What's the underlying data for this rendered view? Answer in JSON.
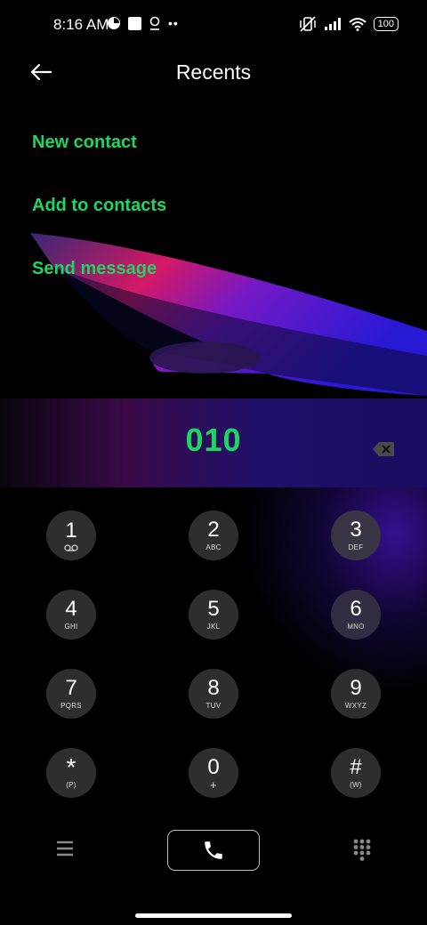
{
  "status_bar": {
    "time": "8:16 AM",
    "battery": "100",
    "icons_left": [
      "data-saver-icon",
      "square-notification-icon",
      "location-pin-icon",
      "more-dots-icon"
    ],
    "icons_right": [
      "vibrate-off-icon",
      "signal-icon",
      "wifi-icon",
      "battery-icon"
    ]
  },
  "header": {
    "title": "Recents",
    "back_icon": "back-arrow-icon"
  },
  "menu": {
    "items": [
      {
        "label": "New contact"
      },
      {
        "label": "Add to contacts"
      },
      {
        "label": "Send message"
      }
    ]
  },
  "dialer": {
    "number": "010",
    "backspace_icon": "backspace-icon"
  },
  "keypad": {
    "keys": [
      {
        "digit": "1",
        "sub": "",
        "sub_icon": "voicemail-icon"
      },
      {
        "digit": "2",
        "sub": "ABC"
      },
      {
        "digit": "3",
        "sub": "DEF"
      },
      {
        "digit": "4",
        "sub": "GHI"
      },
      {
        "digit": "5",
        "sub": "JKL"
      },
      {
        "digit": "6",
        "sub": "MNO"
      },
      {
        "digit": "7",
        "sub": "PQRS"
      },
      {
        "digit": "8",
        "sub": "TUV"
      },
      {
        "digit": "9",
        "sub": "WXYZ"
      },
      {
        "digit": "*",
        "sub": "(P)"
      },
      {
        "digit": "0",
        "sub": "+"
      },
      {
        "digit": "#",
        "sub": "(W)"
      }
    ]
  },
  "bottom_bar": {
    "menu_icon": "hamburger-icon",
    "call_icon": "phone-icon",
    "dialpad_icon": "dialpad-icon"
  },
  "colors": {
    "accent": "#1ed760",
    "key_bg": "#2e2e2e",
    "background": "#000000"
  }
}
